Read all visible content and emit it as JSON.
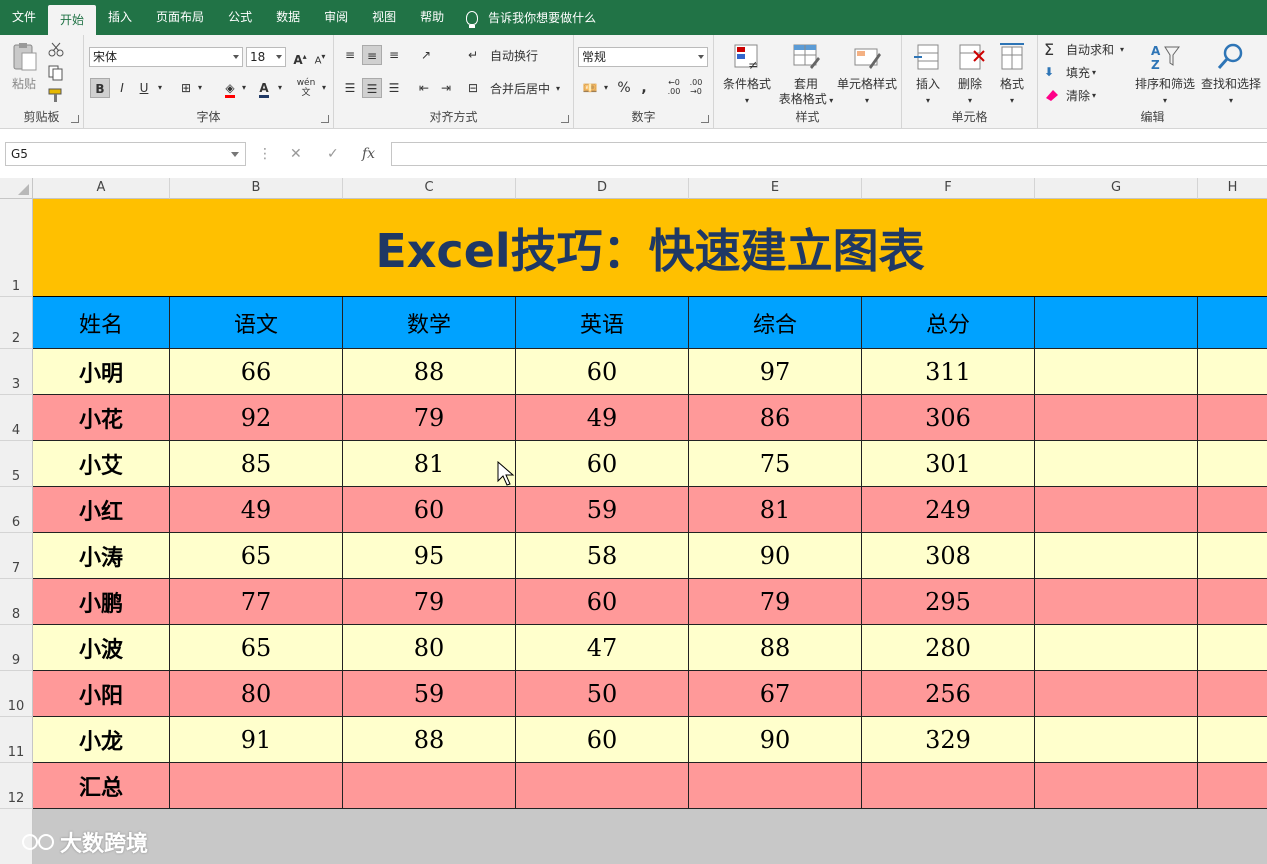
{
  "tabs": [
    "文件",
    "开始",
    "插入",
    "页面布局",
    "公式",
    "数据",
    "审阅",
    "视图",
    "帮助"
  ],
  "active_tab": "开始",
  "tell_me": "告诉我你想要做什么",
  "ribbon": {
    "clipboard": {
      "label": "剪贴板",
      "paste": "粘贴"
    },
    "font": {
      "label": "字体",
      "name": "宋体",
      "size": "18",
      "bold": "B",
      "italic": "I",
      "underline": "U",
      "wen": "wén"
    },
    "align": {
      "label": "对齐方式",
      "wrap": "自动换行",
      "merge": "合并后居中"
    },
    "number": {
      "label": "数字",
      "format": "常规",
      "percent": "%",
      "comma": ","
    },
    "styles": {
      "label": "样式",
      "cond": "条件格式",
      "table_line1": "套用",
      "table_line2": "表格格式",
      "cell": "单元格样式"
    },
    "cells": {
      "label": "单元格",
      "insert": "插入",
      "delete": "删除",
      "format": "格式"
    },
    "edit": {
      "label": "编辑",
      "autosum": "自动求和",
      "fill": "填充",
      "clear": "清除",
      "sort": "排序和筛选",
      "find": "查找和选择"
    }
  },
  "formula_bar": {
    "name_box": "G5",
    "fx": "fx",
    "cancel": "✕",
    "enter": "✓",
    "value": ""
  },
  "columns": [
    "A",
    "B",
    "C",
    "D",
    "E",
    "F",
    "G",
    "H"
  ],
  "rows": [
    "1",
    "2",
    "3",
    "4",
    "5",
    "6",
    "7",
    "8",
    "9",
    "10",
    "11",
    "12"
  ],
  "sheet": {
    "title": "Excel技巧：快速建立图表",
    "headers": [
      "姓名",
      "语文",
      "数学",
      "英语",
      "综合",
      "总分"
    ],
    "data": [
      [
        "小明",
        "66",
        "88",
        "60",
        "97",
        "311"
      ],
      [
        "小花",
        "92",
        "79",
        "49",
        "86",
        "306"
      ],
      [
        "小艾",
        "85",
        "81",
        "60",
        "75",
        "301"
      ],
      [
        "小红",
        "49",
        "60",
        "59",
        "81",
        "249"
      ],
      [
        "小涛",
        "65",
        "95",
        "58",
        "90",
        "308"
      ],
      [
        "小鹏",
        "77",
        "79",
        "60",
        "79",
        "295"
      ],
      [
        "小波",
        "65",
        "80",
        "47",
        "88",
        "280"
      ],
      [
        "小阳",
        "80",
        "59",
        "50",
        "67",
        "256"
      ],
      [
        "小龙",
        "91",
        "88",
        "60",
        "90",
        "329"
      ],
      [
        "汇总",
        "",
        "",
        "",
        "",
        ""
      ]
    ]
  },
  "colors": {
    "header": "#00a2ff",
    "title_bg": "#ffc000",
    "title_text": "#1f3864",
    "odd_row": "#ffffcc",
    "even_row": "#ff9999",
    "ribbon": "#217346"
  },
  "watermark": "大数跨境"
}
